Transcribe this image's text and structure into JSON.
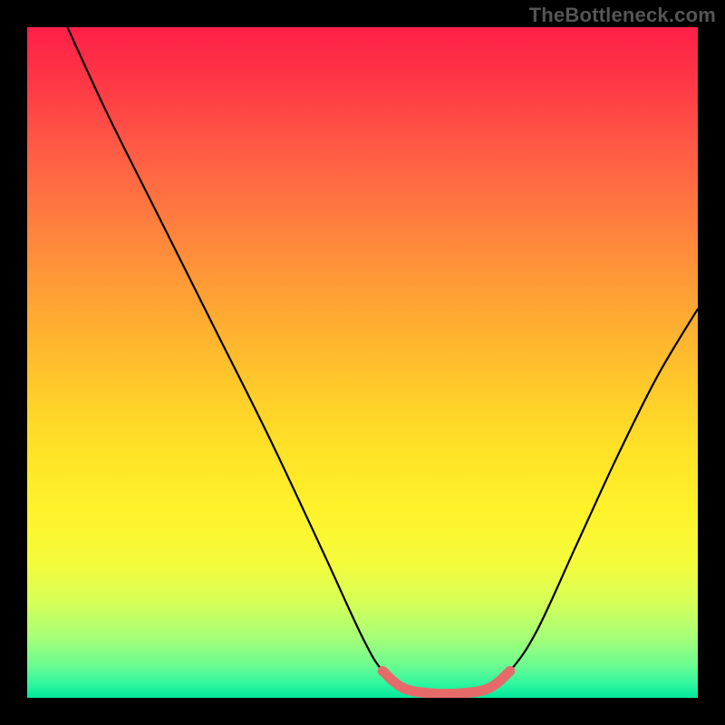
{
  "watermark": "TheBottleneck.com",
  "chart_data": {
    "type": "line",
    "title": "",
    "xlabel": "",
    "ylabel": "",
    "xlim": [
      0,
      100
    ],
    "ylim": [
      0,
      100
    ],
    "series": [
      {
        "name": "curve",
        "points": [
          {
            "x": 6,
            "y": 100
          },
          {
            "x": 12,
            "y": 87
          },
          {
            "x": 20,
            "y": 71
          },
          {
            "x": 28,
            "y": 55
          },
          {
            "x": 36,
            "y": 39
          },
          {
            "x": 44,
            "y": 22
          },
          {
            "x": 50,
            "y": 9
          },
          {
            "x": 53,
            "y": 4
          },
          {
            "x": 56,
            "y": 1.5
          },
          {
            "x": 60,
            "y": 0.7
          },
          {
            "x": 65,
            "y": 0.7
          },
          {
            "x": 69,
            "y": 1.5
          },
          {
            "x": 72,
            "y": 4
          },
          {
            "x": 76,
            "y": 10
          },
          {
            "x": 82,
            "y": 23
          },
          {
            "x": 88,
            "y": 36
          },
          {
            "x": 94,
            "y": 48
          },
          {
            "x": 100,
            "y": 58
          }
        ]
      },
      {
        "name": "bottom-marker",
        "color": "#e66a6a",
        "points": [
          {
            "x": 53,
            "y": 4
          },
          {
            "x": 56,
            "y": 1.5
          },
          {
            "x": 60,
            "y": 0.7
          },
          {
            "x": 65,
            "y": 0.7
          },
          {
            "x": 69,
            "y": 1.5
          },
          {
            "x": 72,
            "y": 4
          }
        ]
      }
    ],
    "grid": false,
    "legend": false
  }
}
